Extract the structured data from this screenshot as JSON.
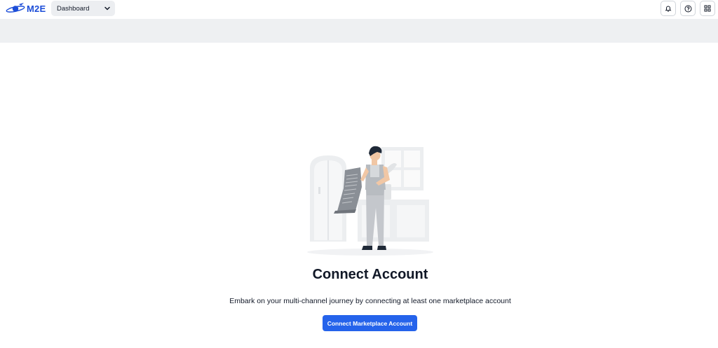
{
  "header": {
    "logo_text": "M2E",
    "nav_select_value": "Dashboard",
    "icons": [
      "bell-icon",
      "help-circle-icon",
      "apps-grid-icon"
    ]
  },
  "empty_state": {
    "title": "Connect Account",
    "description": "Embark on your multi-channel journey by connecting at least one marketplace account",
    "button_label": "Connect Marketplace Account"
  },
  "colors": {
    "brand": "#1d4ed8",
    "primary_button": "#2563eb",
    "band": "#eef0f2"
  }
}
